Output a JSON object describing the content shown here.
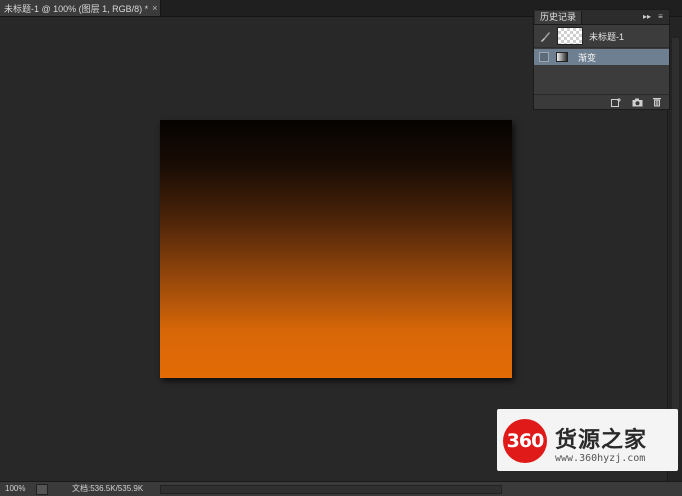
{
  "document_tab": {
    "title": "未标题-1 @ 100% (图层 1, RGB/8) *",
    "close": "×"
  },
  "history_panel": {
    "tab_label": "历史记录",
    "collapse": "▸▸",
    "menu": "≡",
    "snapshot": {
      "label": "未标题-1"
    },
    "items": [
      {
        "label": "渐变",
        "selected": true
      }
    ]
  },
  "canvas": {
    "gradient_top_color": "#050302",
    "gradient_bottom_color": "#e46b05"
  },
  "status_bar": {
    "zoom": "100%",
    "doc_info": "文档:536.5K/535.9K"
  },
  "watermark": {
    "logo_text": "360",
    "title": "货源之家",
    "url": "www.360hyzj.com"
  },
  "colors": {
    "accent_orange": "#e46b05",
    "selection_blue": "#6f7f92",
    "logo_red": "#e01919"
  }
}
